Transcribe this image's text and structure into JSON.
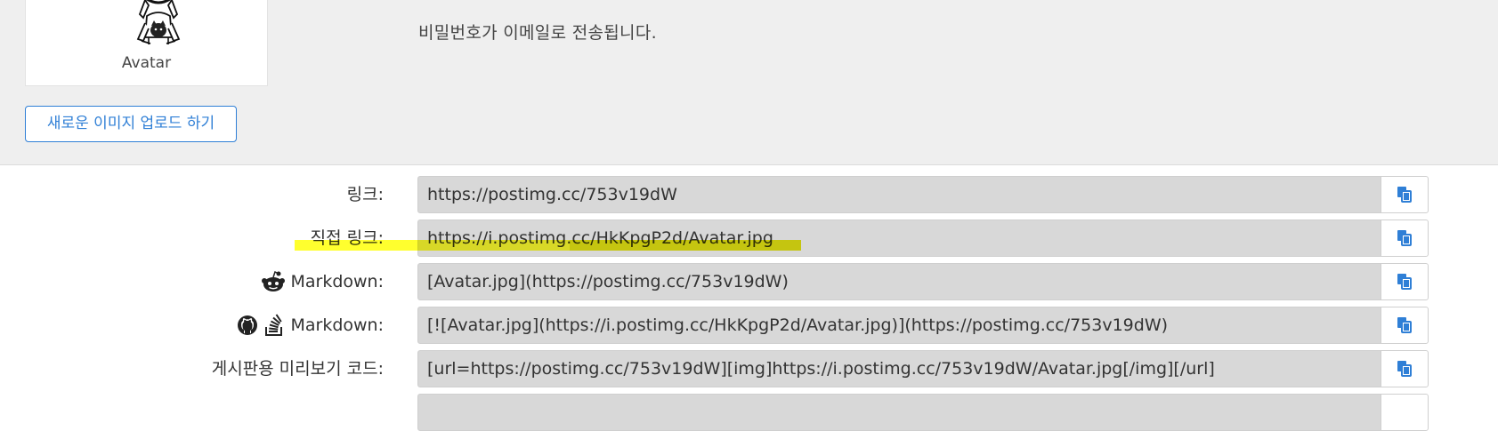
{
  "avatar": {
    "caption": "Avatar"
  },
  "info": {
    "message": "비밀번호가 이메일로 전송됩니다."
  },
  "upload": {
    "button_label": "새로운 이미지 업로드 하기"
  },
  "links": [
    {
      "label": "링크:",
      "value": "https://postimg.cc/753v19dW"
    },
    {
      "label": "직접 링크:",
      "value": "https://i.postimg.cc/HkKpgP2d/Avatar.jpg"
    },
    {
      "label": "Markdown:",
      "value": "[Avatar.jpg](https://postimg.cc/753v19dW)",
      "icons": [
        "reddit-icon"
      ]
    },
    {
      "label": "Markdown:",
      "value": "[![Avatar.jpg](https://i.postimg.cc/HkKpgP2d/Avatar.jpg)](https://postimg.cc/753v19dW)",
      "icons": [
        "github-icon",
        "stack-overflow-icon"
      ]
    },
    {
      "label": "게시판용 미리보기 코드:",
      "value": "[url=https://postimg.cc/753v19dW][img]https://i.postimg.cc/753v19dW/Avatar.jpg[/img][/url]"
    }
  ],
  "colors": {
    "accent": "#2f7fd6",
    "highlight": "#ffff00",
    "input_background": "#d8d8d8",
    "top_background": "#efefef"
  }
}
